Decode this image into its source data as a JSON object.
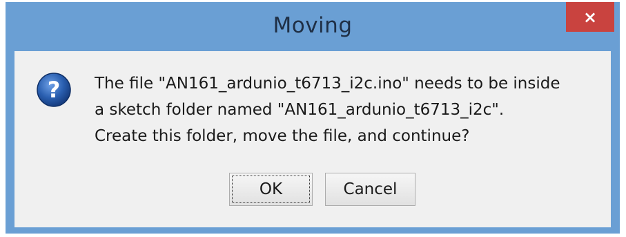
{
  "dialog": {
    "title": "Moving",
    "close_label": "×",
    "message_lines": [
      "The file \"AN161_ardunio_t6713_i2c.ino\" needs to be inside",
      "a sketch folder named \"AN161_ardunio_t6713_i2c\".",
      "Create this folder, move the file, and continue?"
    ],
    "icon": "question-icon",
    "buttons": {
      "ok_label": "OK",
      "cancel_label": "Cancel"
    }
  },
  "colors": {
    "titlebar": "#6a9fd4",
    "close_button": "#c9433f",
    "client_background": "#f0f0f0",
    "icon_blue": "#2a5fb0"
  }
}
